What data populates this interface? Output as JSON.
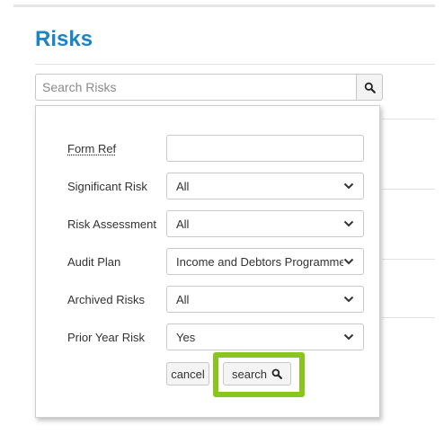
{
  "page": {
    "title": "Risks"
  },
  "search": {
    "placeholder": "Search Risks",
    "value": ""
  },
  "filters": {
    "form_ref": {
      "label": "Form Ref",
      "value": ""
    },
    "significant_risk": {
      "label": "Significant Risk",
      "value": "All"
    },
    "risk_assessment": {
      "label": "Risk Assessment",
      "value": "All"
    },
    "audit_plan": {
      "label": "Audit Plan",
      "value": "Income and Debtors Programme"
    },
    "archived_risks": {
      "label": "Archived Risks",
      "value": "All"
    },
    "prior_year_risk": {
      "label": "Prior Year Risk",
      "value": "Yes"
    }
  },
  "buttons": {
    "cancel": "cancel",
    "search": "search"
  },
  "icons": {
    "search": "search-icon",
    "dropdown": "chevron-down-icon"
  },
  "colors": {
    "title": "#1b84c6",
    "highlight": "#8ac51b"
  }
}
